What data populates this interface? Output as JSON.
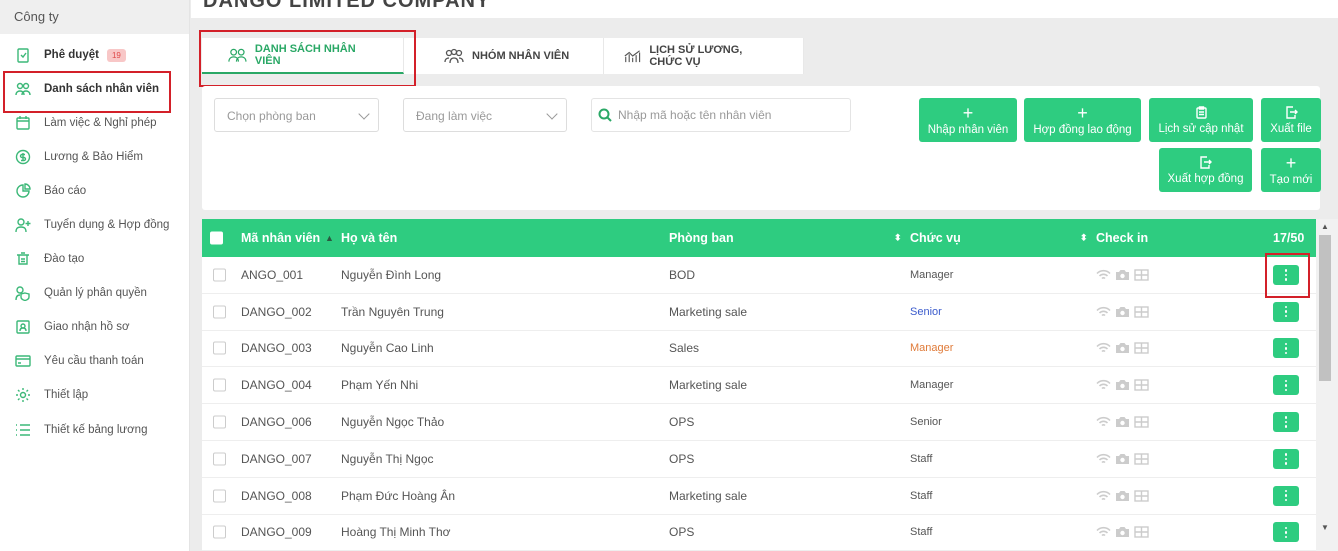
{
  "company_title": "DANGO LIMITED COMPANY",
  "sidebar": {
    "header": "Công ty",
    "items": [
      {
        "label": "Phê duyệt",
        "badge": "19"
      },
      {
        "label": "Danh sách nhân viên"
      },
      {
        "label": "Làm việc & Nghỉ phép"
      },
      {
        "label": "Lương & Bảo Hiểm"
      },
      {
        "label": "Báo cáo"
      },
      {
        "label": "Tuyển dụng & Hợp đồng"
      },
      {
        "label": "Đào tạo"
      },
      {
        "label": "Quản lý phân quyền"
      },
      {
        "label": "Giao nhận hồ sơ"
      },
      {
        "label": "Yêu cầu thanh toán"
      },
      {
        "label": "Thiết lập"
      },
      {
        "label": "Thiết kế bảng lương"
      }
    ]
  },
  "tabs": [
    "DANH SÁCH NHÂN VIÊN",
    "NHÓM NHÂN VIÊN",
    "LỊCH SỬ LƯƠNG, CHỨC VỤ"
  ],
  "filters": {
    "department_placeholder": "Chọn phòng ban",
    "status_value": "Đang làm việc",
    "search_placeholder": "Nhập mã hoặc tên nhân viên"
  },
  "buttons": {
    "import": "Nhập nhân viên",
    "contract": "Hợp đồng lao động",
    "history": "Lịch sử cập nhật",
    "export_file": "Xuất file",
    "export_contract": "Xuất hợp đồng",
    "create": "Tạo mới"
  },
  "table": {
    "headers": {
      "code": "Mã nhân viên",
      "name": "Họ và tên",
      "dept": "Phòng ban",
      "position": "Chức vụ",
      "checkin": "Check in",
      "count": "17/50"
    },
    "rows": [
      {
        "code": "ANGO_001",
        "name": "Nguyễn Đình Long",
        "dept": "BOD",
        "position": "Manager",
        "pos_color": "#555555"
      },
      {
        "code": "DANGO_002",
        "name": "Trần Nguyên Trung",
        "dept": "Marketing sale",
        "position": "Senior",
        "pos_color": "#3b5bcc"
      },
      {
        "code": "DANGO_003",
        "name": "Nguyễn Cao Linh",
        "dept": "Sales",
        "position": "Manager",
        "pos_color": "#e07b39"
      },
      {
        "code": "DANGO_004",
        "name": "Phạm Yến Nhi",
        "dept": "Marketing sale",
        "position": "Manager",
        "pos_color": "#555555"
      },
      {
        "code": "DANGO_006",
        "name": "Nguyễn Ngọc Thảo",
        "dept": "OPS",
        "position": "Senior",
        "pos_color": "#555555"
      },
      {
        "code": "DANGO_007",
        "name": "Nguyễn Thị Ngọc",
        "dept": "OPS",
        "position": "Staff",
        "pos_color": "#555555"
      },
      {
        "code": "DANGO_008",
        "name": "Phạm Đức Hoàng Ân",
        "dept": "Marketing sale",
        "position": "Staff",
        "pos_color": "#555555"
      },
      {
        "code": "DANGO_009",
        "name": "Hoàng Thị Minh Thơ",
        "dept": "OPS",
        "position": "Staff",
        "pos_color": "#555555"
      }
    ]
  },
  "colors": {
    "accent": "#2ecc80",
    "highlight": "#d32029"
  }
}
